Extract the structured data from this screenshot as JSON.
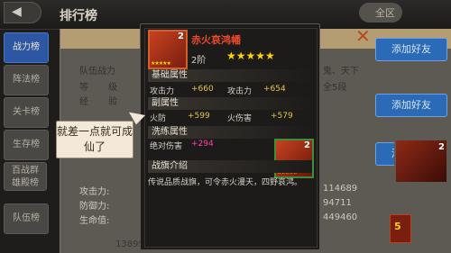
{
  "header": {
    "back_icon": "back-arrow-icon",
    "title": "排行榜",
    "toggle_label": "全区"
  },
  "tabs": [
    {
      "label": "战力榜",
      "active": true
    },
    {
      "label": "阵法榜",
      "active": false
    },
    {
      "label": "关卡榜",
      "active": false
    },
    {
      "label": "生存榜",
      "active": false
    },
    {
      "label": "百战群\n雄殿榜",
      "active": false
    },
    {
      "label": "队伍榜",
      "active": false
    }
  ],
  "background_panel": {
    "row1": "队伍战力",
    "row2_labels": [
      "等",
      "级"
    ],
    "row3_labels": [
      "经",
      "验"
    ],
    "row1_right": "鬼、天下",
    "row2_right": "全5段",
    "lower_labels": [
      "攻击力:",
      "防御力:",
      "生命值:"
    ],
    "lower_values": [
      "114689",
      "94711",
      "449460"
    ],
    "bottom_values": [
      "1389990"
    ],
    "buttons": [
      "添加好友",
      "添加好友",
      "添加好友"
    ]
  },
  "item": {
    "name": "赤火哀鸿幡",
    "level_badge": "2",
    "tier": "2阶",
    "stars": 5,
    "sections": {
      "basic": {
        "title": "基础属性",
        "stats": [
          {
            "label": "攻击力",
            "value": "+660"
          },
          {
            "label": "攻击力",
            "value": "+654"
          }
        ]
      },
      "secondary": {
        "title": "副属性",
        "stats": [
          {
            "label": "火防",
            "value": "+599"
          },
          {
            "label": "火伤害",
            "value": "+579"
          }
        ]
      },
      "training": {
        "title": "洗练属性",
        "stats": [
          {
            "label": "绝对伤害",
            "value": "+294"
          }
        ]
      },
      "intro": {
        "title": "战旗介绍",
        "text": "传说品质战旗，可令赤火漫天，四野哀鸿。"
      }
    }
  },
  "bubble": {
    "text": "就差一点就可成仙了"
  },
  "colors": {
    "accent_blue": "#2d57a3",
    "item_name_red": "#ea4a2a",
    "stat_gold": "#e3c44a",
    "pink": "#ff3fa8"
  }
}
